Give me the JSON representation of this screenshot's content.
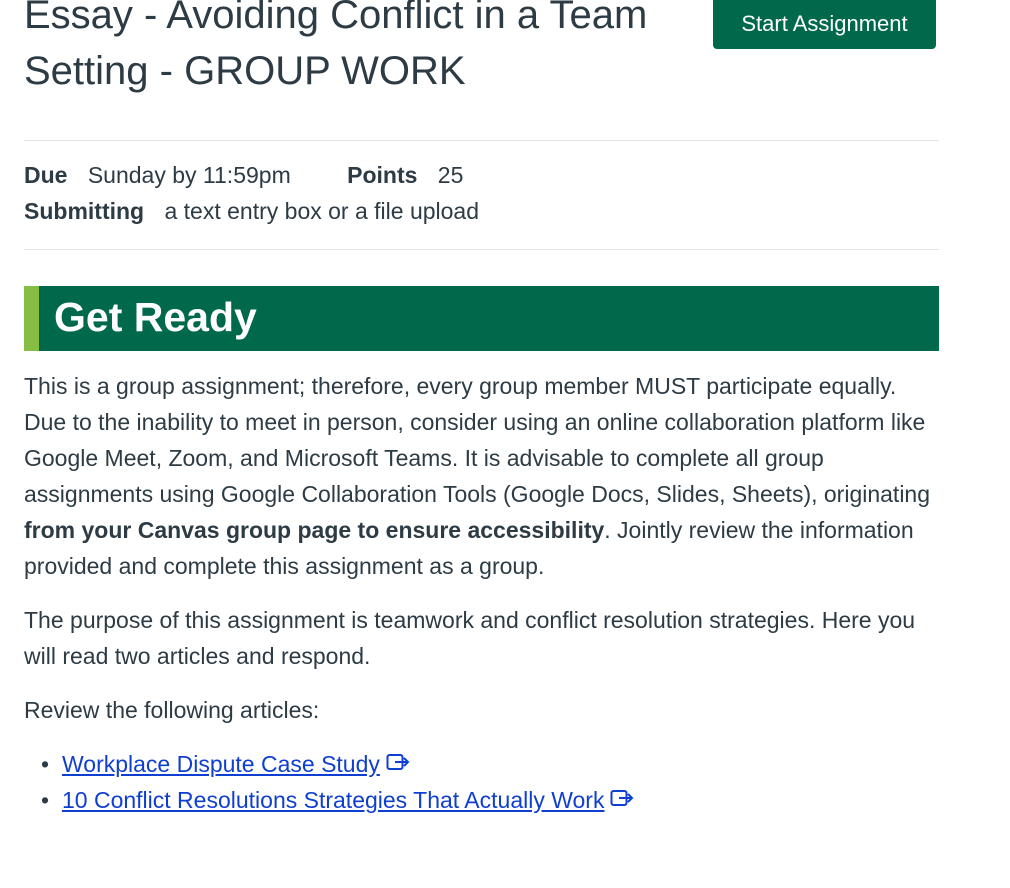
{
  "page": {
    "title": "Essay - Avoiding Conflict in a Team Setting - GROUP WORK",
    "start_button": "Start Assignment"
  },
  "details": {
    "due_label": "Due",
    "due_value": "Sunday by 11:59pm",
    "points_label": "Points",
    "points_value": "25",
    "submitting_label": "Submitting",
    "submitting_value": "a text entry box or a file upload"
  },
  "content": {
    "section_heading": "Get Ready",
    "para1_a": "This is a group assignment; therefore, every group member MUST participate equally. Due to the inability to meet in person, consider using an online collaboration platform like Google Meet, Zoom, and Microsoft Teams. It is advisable to complete all group assignments using Google Collaboration Tools (Google Docs, Slides, Sheets), originating ",
    "para1_bold": "from your Canvas group page to ensure accessibility",
    "para1_b": ". Jointly review the information provided and complete this assignment as a group.",
    "para2": "The purpose of this assignment is teamwork and conflict resolution strategies. Here you will read two articles and respond.",
    "para3": "Review the following articles:",
    "links": [
      {
        "label": "Workplace Dispute Case Study",
        "icon": "external-link-icon"
      },
      {
        "label": "10 Conflict Resolutions Strategies That Actually Work",
        "icon": "external-link-icon"
      }
    ]
  },
  "colors": {
    "brand_green": "#00694b",
    "accent_green": "#86bd43",
    "link": "#0f3fd0",
    "text": "#2d3b45"
  }
}
